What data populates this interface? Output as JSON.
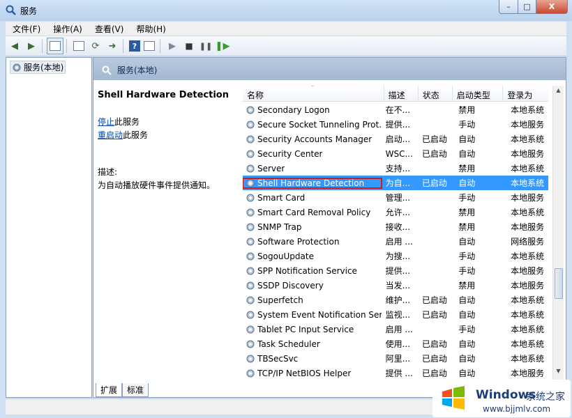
{
  "window": {
    "title": "服务",
    "min": "–",
    "max": "□",
    "close": "X"
  },
  "menu": [
    "文件(F)",
    "操作(A)",
    "查看(V)",
    "帮助(H)"
  ],
  "left_tree": {
    "item": "服务(本地)"
  },
  "pane": {
    "header": "服务(本地)"
  },
  "description": {
    "title": "Shell Hardware Detection",
    "stop_link": "停止",
    "stop_suffix": "此服务",
    "restart_link": "重启动",
    "restart_suffix": "此服务",
    "label": "描述:",
    "text": "为自动播放硬件事件提供通知。"
  },
  "columns": [
    "名称",
    "描述",
    "状态",
    "启动类型",
    "登录为"
  ],
  "rows": [
    {
      "name": "Secondary Logon",
      "desc": "在不...",
      "status": "",
      "startup": "禁用",
      "logon": "本地系统"
    },
    {
      "name": "Secure Socket Tunneling Prot...",
      "desc": "提供...",
      "status": "",
      "startup": "手动",
      "logon": "本地服务"
    },
    {
      "name": "Security Accounts Manager",
      "desc": "启动...",
      "status": "已启动",
      "startup": "自动",
      "logon": "本地系统"
    },
    {
      "name": "Security Center",
      "desc": "WSC...",
      "status": "已启动",
      "startup": "自动",
      "logon": "本地服务"
    },
    {
      "name": "Server",
      "desc": "支持...",
      "status": "",
      "startup": "禁用",
      "logon": "本地系统"
    },
    {
      "name": "Shell Hardware Detection",
      "desc": "为自...",
      "status": "已启动",
      "startup": "自动",
      "logon": "本地系统",
      "selected": true
    },
    {
      "name": "Smart Card",
      "desc": "管理...",
      "status": "",
      "startup": "手动",
      "logon": "本地服务"
    },
    {
      "name": "Smart Card Removal Policy",
      "desc": "允许...",
      "status": "",
      "startup": "禁用",
      "logon": "本地系统"
    },
    {
      "name": "SNMP Trap",
      "desc": "接收...",
      "status": "",
      "startup": "禁用",
      "logon": "本地服务"
    },
    {
      "name": "Software Protection",
      "desc": "启用 ...",
      "status": "",
      "startup": "自动",
      "logon": "网络服务"
    },
    {
      "name": "SogouUpdate",
      "desc": "为搜...",
      "status": "",
      "startup": "手动",
      "logon": "本地系统"
    },
    {
      "name": "SPP Notification Service",
      "desc": "提供...",
      "status": "",
      "startup": "手动",
      "logon": "本地服务"
    },
    {
      "name": "SSDP Discovery",
      "desc": "当发...",
      "status": "",
      "startup": "禁用",
      "logon": "本地服务"
    },
    {
      "name": "Superfetch",
      "desc": "维护...",
      "status": "已启动",
      "startup": "自动",
      "logon": "本地系统"
    },
    {
      "name": "System Event Notification Ser...",
      "desc": "监视...",
      "status": "已启动",
      "startup": "自动",
      "logon": "本地系统"
    },
    {
      "name": "Tablet PC Input Service",
      "desc": "启用 ...",
      "status": "",
      "startup": "手动",
      "logon": "本地系统"
    },
    {
      "name": "Task Scheduler",
      "desc": "使用...",
      "status": "已启动",
      "startup": "自动",
      "logon": "本地系统"
    },
    {
      "name": "TBSecSvc",
      "desc": "阿里...",
      "status": "已启动",
      "startup": "自动",
      "logon": "本地系统"
    },
    {
      "name": "TCP/IP NetBIOS Helper",
      "desc": "提供 ...",
      "status": "已启动",
      "startup": "自动",
      "logon": "本地服务"
    }
  ],
  "tabs": [
    "扩展",
    "标准"
  ],
  "watermark": {
    "brand": "Windows",
    "cn": "系统之家",
    "url": "www.bjjmlv.com"
  },
  "colors": {
    "selected_row": "#3399ff",
    "highlight_border": "#d01b1b"
  }
}
